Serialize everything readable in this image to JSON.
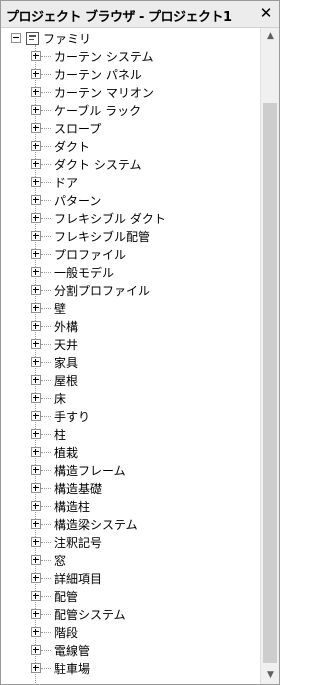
{
  "window": {
    "title": "プロジェクト ブラウザ - プロジェクト1",
    "close_glyph": "✕"
  },
  "tree": {
    "root_label": "ファミリ",
    "items": [
      "カーテン システム",
      "カーテン パネル",
      "カーテン マリオン",
      "ケーブル ラック",
      "スロープ",
      "ダクト",
      "ダクト システム",
      "ドア",
      "パターン",
      "フレキシブル ダクト",
      "フレキシブル配管",
      "プロファイル",
      "一般モデル",
      "分割プロファイル",
      "壁",
      "外構",
      "天井",
      "家具",
      "屋根",
      "床",
      "手すり",
      "柱",
      "植栽",
      "構造フレーム",
      "構造基礎",
      "構造柱",
      "構造梁システム",
      "注釈記号",
      "窓",
      "詳細項目",
      "配管",
      "配管システム",
      "階段",
      "電線管",
      "駐車場"
    ]
  },
  "scrollbar": {
    "up_glyph": "▲",
    "down_glyph": "▼"
  }
}
